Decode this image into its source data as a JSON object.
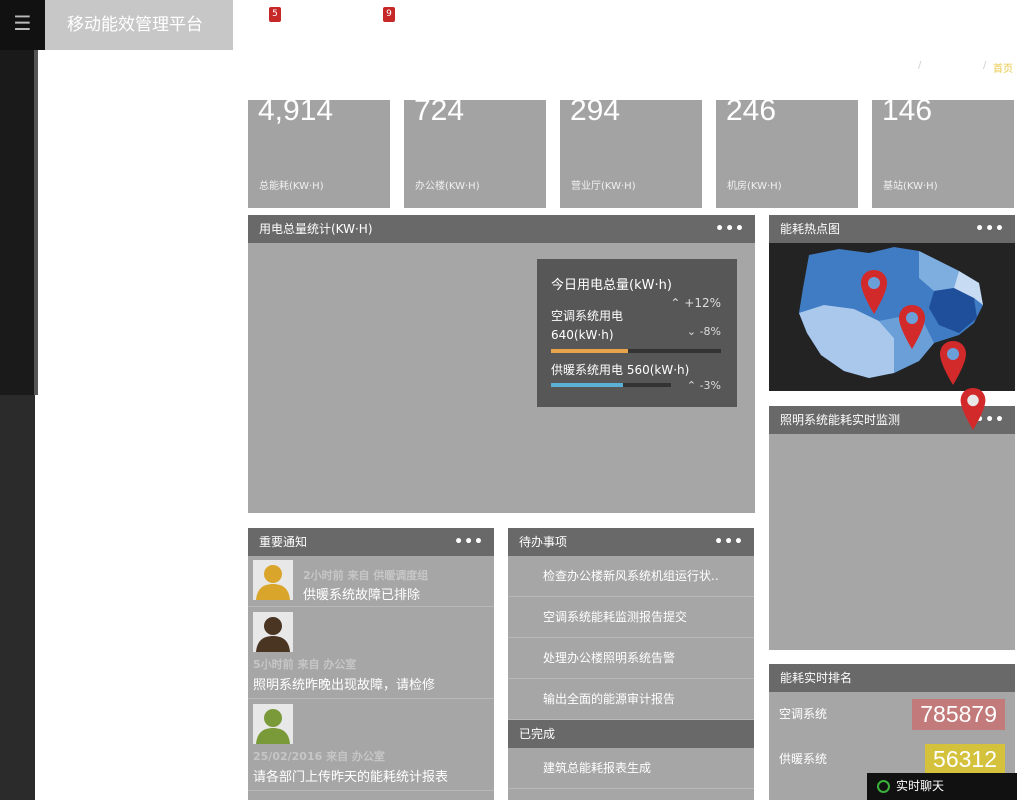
{
  "header": {
    "brand": "移动能效管理平台",
    "menu_icon": "hamburger-icon",
    "badges": [
      "5",
      "9"
    ],
    "breadcrumb": {
      "sep1": "/",
      "sep2": "/",
      "home": "首页"
    }
  },
  "stats": [
    {
      "value": "4,914",
      "label": "总能耗(KW·H)"
    },
    {
      "value": "724",
      "label": "办公楼(KW·H)"
    },
    {
      "value": "294",
      "label": "营业厅(KW·H)"
    },
    {
      "value": "246",
      "label": "机房(KW·H)"
    },
    {
      "value": "146",
      "label": "基站(KW·H)"
    }
  ],
  "usage_panel": {
    "title": "用电总量统计(KW·H)",
    "tooltip": {
      "title": "今日用电总量(kW·h)",
      "up_change": "+12%",
      "ac_label": "空调系统用电",
      "ac_value": "640(kW·h)",
      "ac_change": "-8%",
      "ac_progress": 0.45,
      "heat_label": "供暖系统用电 560(kW·h)",
      "heat_change": "-3%",
      "heat_progress": 0.6
    }
  },
  "heatmap": {
    "title": "能耗热点图"
  },
  "lighting": {
    "title": "照明系统能耗实时监测"
  },
  "notices": {
    "title": "重要通知",
    "items": [
      {
        "meta": "2小时前 来自 供暖调度组",
        "text": "供暖系统故障已排除",
        "avatar_color": "#d9a62b"
      },
      {
        "meta": "5小时前 来自 办公室",
        "text": "照明系统昨晚出现故障，请检修",
        "avatar_color": "#4a3422"
      },
      {
        "meta": "25/02/2016 来自 办公室",
        "text": "请各部门上传昨天的能耗统计报表",
        "avatar_color": "#7a9a3a"
      }
    ]
  },
  "todos": {
    "title": "待办事项",
    "pending": [
      "检查办公楼新风系统机组运行状..",
      "空调系统能耗监测报告提交",
      "处理办公楼照明系统告警",
      "输出全面的能源审计报告"
    ],
    "done_title": "已完成",
    "done": [
      "建筑总能耗报表生成"
    ]
  },
  "ranking": {
    "title": "能耗实时排名",
    "rows": [
      {
        "label": "空调系统",
        "value": "785879",
        "color": "#c27a7a"
      },
      {
        "label": "供暖系统",
        "value": "56312",
        "color": "#d4c23c"
      }
    ]
  },
  "chat": {
    "label": "实时聊天"
  },
  "more_label": "•••"
}
